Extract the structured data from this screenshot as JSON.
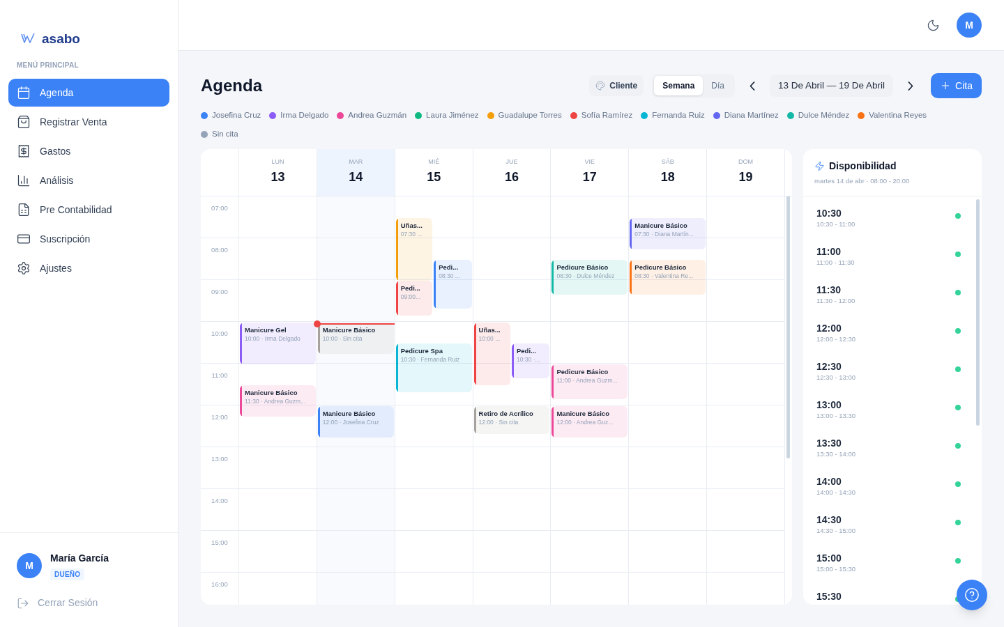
{
  "sidebar": {
    "logo": "asabo",
    "section_label": "MENÚ PRINCIPAL",
    "items": [
      {
        "label": "Agenda",
        "selected": true
      },
      {
        "label": "Registrar Venta",
        "selected": false
      },
      {
        "label": "Gastos",
        "selected": false
      },
      {
        "label": "Análisis",
        "selected": false
      },
      {
        "label": "Pre Contabilidad",
        "selected": false
      },
      {
        "label": "Suscripción",
        "selected": false
      },
      {
        "label": "Ajustes",
        "selected": false
      }
    ],
    "user": {
      "initial": "M",
      "name": "María García",
      "role": "DUEÑO"
    },
    "logout": "Cerrar Sesión"
  },
  "topbar": {
    "avatar": "M"
  },
  "page": {
    "title": "Agenda",
    "client_button": "Cliente",
    "views": [
      {
        "label": "Semana",
        "selected": true
      },
      {
        "label": "Día",
        "selected": false
      }
    ],
    "date_range": "13 De Abril — 19 De Abril",
    "new_button": "Cita",
    "legend": [
      {
        "label": "Josefina Cruz",
        "color": "#3b82f6"
      },
      {
        "label": "Irma Delgado",
        "color": "#8b5cf6"
      },
      {
        "label": "Andrea Guzmán",
        "color": "#ec4899"
      },
      {
        "label": "Laura Jiménez",
        "color": "#10b981"
      },
      {
        "label": "Guadalupe Torres",
        "color": "#f59e0b"
      },
      {
        "label": "Sofía Ramírez",
        "color": "#ef4444"
      },
      {
        "label": "Fernanda Ruiz",
        "color": "#06b6d4"
      },
      {
        "label": "Diana Martínez",
        "color": "#6366f1"
      },
      {
        "label": "Dulce Méndez",
        "color": "#14b8a6"
      },
      {
        "label": "Valentina Reyes",
        "color": "#f97316"
      },
      {
        "label": "Sin cita",
        "color": "#94a3b8"
      }
    ]
  },
  "calendar": {
    "hours": [
      "07:00",
      "08:00",
      "09:00",
      "10:00",
      "11:00",
      "12:00",
      "13:00",
      "14:00",
      "15:00",
      "16:00"
    ],
    "days": [
      {
        "weekday": "LUN",
        "date": "13",
        "today": false,
        "events": [
          {
            "title": "Manicure Gel",
            "subtitle": "10:00 · Irma Delgado",
            "color": "#8b5cf6"
          },
          {
            "title": "Manicure Básico",
            "subtitle": "11:30 · Andrea Guzm...",
            "color": "#ec4899"
          }
        ]
      },
      {
        "weekday": "MAR",
        "date": "14",
        "today": true,
        "events": [
          {
            "title": "Manicure Básico",
            "subtitle": "10:00 · Sin cita",
            "color": "#a8a29e"
          },
          {
            "title": "Manicure Básico",
            "subtitle": "12:00 · Josefina Cruz",
            "color": "#3b82f6"
          }
        ]
      },
      {
        "weekday": "MIÉ",
        "date": "15",
        "today": false,
        "events": [
          {
            "title": "Uñas...",
            "subtitle": "07:30 ...",
            "color": "#f59e0b"
          },
          {
            "title": "Pedi...",
            "subtitle": "08:30 ...",
            "color": "#3b82f6"
          },
          {
            "title": "Pedi...",
            "subtitle": "09:00...",
            "color": "#ef4444"
          },
          {
            "title": "Pedicure Spa",
            "subtitle": "10:30 · Fernanda Ruiz",
            "color": "#06b6d4"
          }
        ]
      },
      {
        "weekday": "JUE",
        "date": "16",
        "today": false,
        "events": [
          {
            "title": "Uñas...",
            "subtitle": "10:00 ...",
            "color": "#ef4444"
          },
          {
            "title": "Pedi...",
            "subtitle": "10:30 ·...",
            "color": "#8b5cf6"
          },
          {
            "title": "Retiro de Acrílico",
            "subtitle": "12:00 · Sin cita",
            "color": "#a8a29e"
          }
        ]
      },
      {
        "weekday": "VIE",
        "date": "17",
        "today": false,
        "events": [
          {
            "title": "Pedicure Básico",
            "subtitle": "08:30 · Dulce Méndez",
            "color": "#14b8a6"
          },
          {
            "title": "Pedicure Básico",
            "subtitle": "11:00 · Andrea Guzm...",
            "color": "#ec4899"
          },
          {
            "title": "Manicure Básico",
            "subtitle": "12:00 · Andrea Guz...",
            "color": "#ec4899"
          }
        ]
      },
      {
        "weekday": "SÁB",
        "date": "18",
        "today": false,
        "events": [
          {
            "title": "Manicure Básico",
            "subtitle": "07:30 · Diana Martín...",
            "color": "#6366f1"
          },
          {
            "title": "Pedicure Básico",
            "subtitle": "08:30 · Valentina Re...",
            "color": "#f97316"
          }
        ]
      },
      {
        "weekday": "DOM",
        "date": "19",
        "today": false
      }
    ]
  },
  "availability": {
    "title": "Disponibilidad",
    "subtitle": "martes 14 de abr · 08:00 - 20:00",
    "slots": [
      {
        "time": "10:30",
        "range": "10:30 - 11:00"
      },
      {
        "time": "11:00",
        "range": "11:00 - 11:30"
      },
      {
        "time": "11:30",
        "range": "11:30 - 12:00"
      },
      {
        "time": "12:00",
        "range": "12:00 - 12:30"
      },
      {
        "time": "12:30",
        "range": "12:30 - 13:00"
      },
      {
        "time": "13:00",
        "range": "13:00 - 13:30"
      },
      {
        "time": "13:30",
        "range": "13:30 - 14:00"
      },
      {
        "time": "14:00",
        "range": "14:00 - 14:30"
      },
      {
        "time": "14:30",
        "range": "14:30 - 15:00"
      },
      {
        "time": "15:00",
        "range": "15:00 - 15:30"
      },
      {
        "time": "15:30"
      }
    ]
  }
}
